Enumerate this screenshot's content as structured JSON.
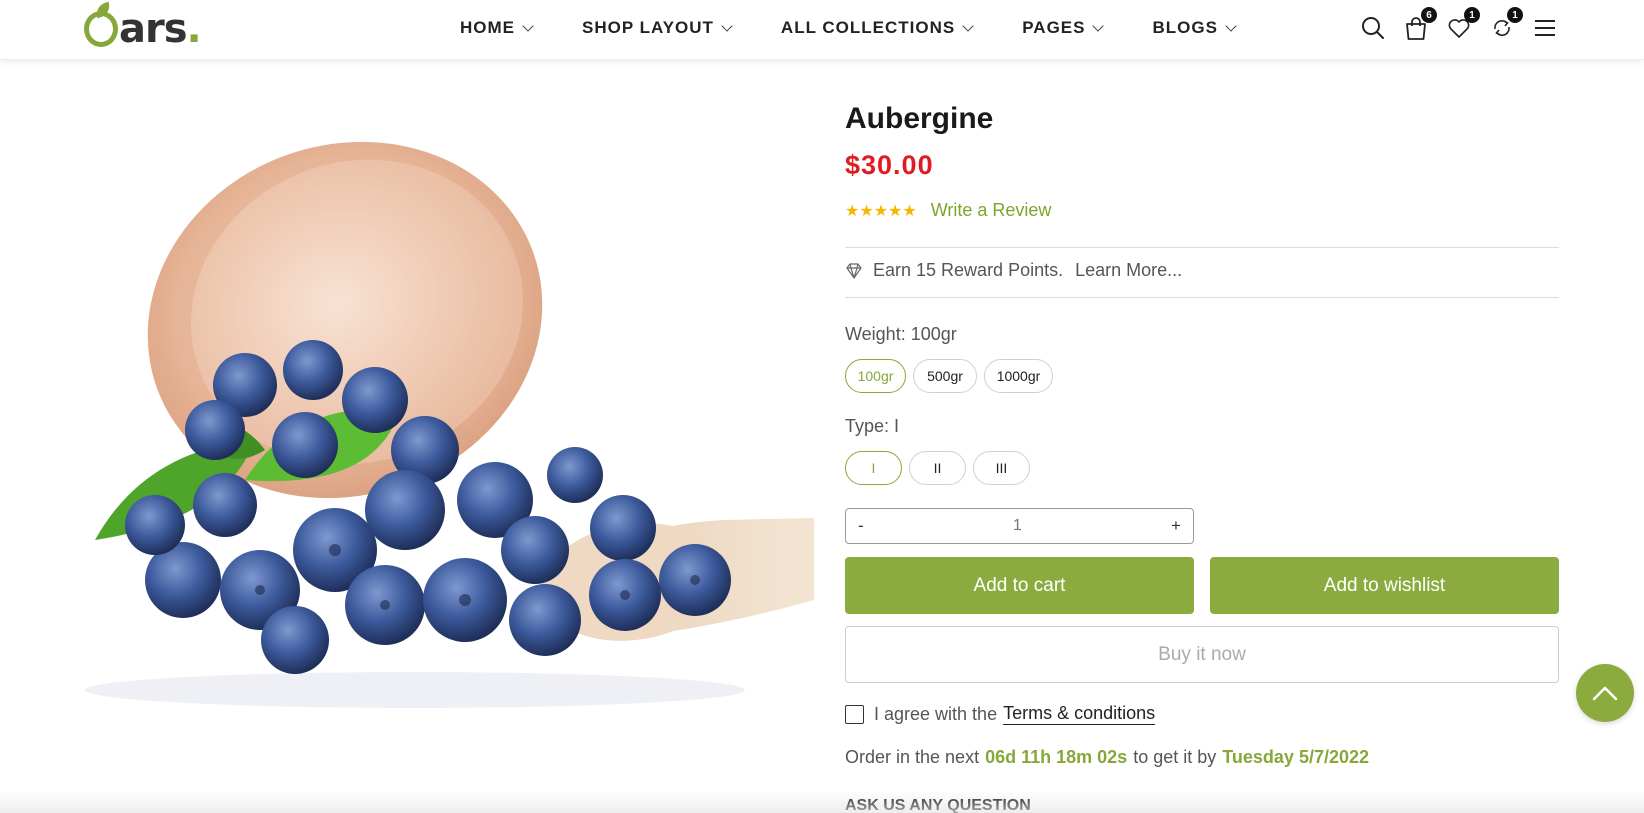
{
  "brand": {
    "logo_text": "ars",
    "logo_dot": "."
  },
  "nav": {
    "items": [
      {
        "label": "HOME"
      },
      {
        "label": "SHOP LAYOUT"
      },
      {
        "label": "ALL COLLECTIONS"
      },
      {
        "label": "PAGES"
      },
      {
        "label": "BLOGS"
      }
    ]
  },
  "header_icons": {
    "search": "search-icon",
    "cart": {
      "icon": "bag-icon",
      "count": "6"
    },
    "wishlist": {
      "icon": "heart-icon",
      "count": "1"
    },
    "compare": {
      "icon": "compare-icon",
      "count": "1"
    },
    "menu": "hamburger-icon"
  },
  "product": {
    "title": "Aubergine",
    "price": "$30.00",
    "rating_stars": "★★★★★",
    "rating_value": 5,
    "review_link": "Write a Review",
    "reward_text": "Earn 15 Reward Points.",
    "reward_learn_more": "Learn More...",
    "weight_label": "Weight: 100gr",
    "weight_options": [
      "100gr",
      "500gr",
      "1000gr"
    ],
    "weight_selected": "100gr",
    "type_label": "Type: I",
    "type_options": [
      "I",
      "II",
      "III"
    ],
    "type_selected": "I",
    "quantity": {
      "minus": "-",
      "value": "1",
      "plus": "+"
    },
    "add_to_cart": "Add to cart",
    "add_to_wishlist": "Add to wishlist",
    "buy_now": "Buy it now",
    "agree_text": "I agree with the",
    "terms_link": "Terms & conditions",
    "order_prefix": "Order in the next",
    "order_countdown": "06d 11h 18m 02s",
    "order_middle": "to get it by",
    "order_date": "Tuesday 5/7/2022",
    "ask_question": "ASK US ANY QUESTION"
  },
  "colors": {
    "accent": "#8cab3f",
    "price": "#e11b22",
    "star": "#f5b800"
  }
}
